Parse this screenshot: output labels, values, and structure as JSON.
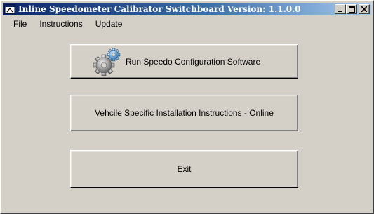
{
  "window": {
    "title": "Inline Speedometer Calibrator Switchboard Version: 1.1.0.0",
    "app_icon": "program-icon",
    "caption_buttons": {
      "minimize": "_",
      "maximize": "□",
      "close": "✕"
    }
  },
  "menu": {
    "items": [
      {
        "label": "File"
      },
      {
        "label": "Instructions"
      },
      {
        "label": "Update"
      }
    ]
  },
  "buttons": {
    "run_label": "Run Speedo Configuration Software",
    "run_icon": "gears-icon",
    "instructions_label": "Vehcile Specific Installation Instructions - Online",
    "exit_label": "Exit",
    "exit_mnemonic": "x"
  }
}
